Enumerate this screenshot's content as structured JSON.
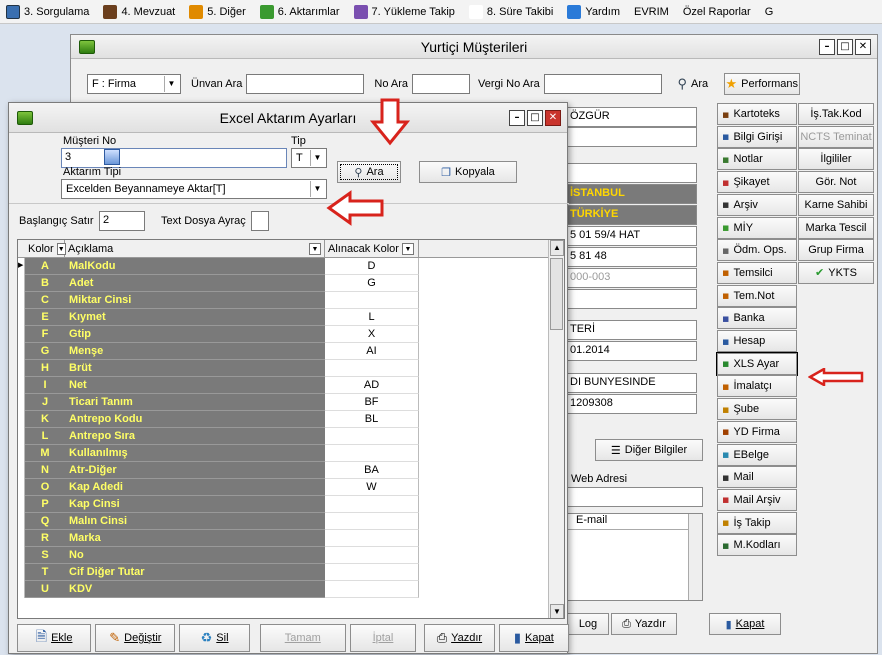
{
  "menubar": {
    "items": [
      {
        "label": "3. Sorgulama",
        "icon": "search-icon"
      },
      {
        "label": "4. Mevzuat",
        "icon": "book-icon"
      },
      {
        "label": "5. Diğer",
        "icon": "people-icon"
      },
      {
        "label": "6. Aktarımlar",
        "icon": "transfer-icon"
      },
      {
        "label": "7. Yükleme Takip",
        "icon": "truck-icon"
      },
      {
        "label": "8. Süre Takibi",
        "icon": "clock-icon"
      },
      {
        "label": "Yardım",
        "icon": "help-icon"
      },
      {
        "label": "EVRIM",
        "icon": ""
      },
      {
        "label": "Özel Raporlar",
        "icon": ""
      },
      {
        "label": "G",
        "icon": ""
      }
    ]
  },
  "main_window": {
    "title": "Yurtiçi Müşterileri",
    "search": {
      "type_value": "F : Firma",
      "unvan_label": "Ünvan Ara",
      "unvan_value": "",
      "no_label": "No Ara",
      "no_value": "",
      "vergi_label": "Vergi No Ara",
      "vergi_value": "",
      "ara_label": "Ara",
      "performans_label": "Performans"
    },
    "fields": {
      "name_partial": "ÖZGÜR",
      "city": "İSTANBUL",
      "country": "TÜRKİYE",
      "phone1": "5 01 59/4 HAT",
      "phone2": "5 81 48",
      "code": "000-003",
      "label_partial": "TERİ",
      "date_partial": "01.2014",
      "office_partial": "DI BUNYESINDE",
      "number_partial": "1209308",
      "diger_bilgiler": "Diğer Bilgiler",
      "web_label": "Web Adresi",
      "email_label": "E-mail",
      "log_label": "Log",
      "yazdir_label": "Yazdır",
      "kapat_label": "Kapat"
    },
    "side_buttons_left": [
      "Kartoteks",
      "Bilgi Girişi",
      "Notlar",
      "Şikayet",
      "Arşiv",
      "MİY",
      "Ödm. Ops.",
      "Temsilci",
      "Tem.Not",
      "Banka",
      "Hesap",
      "XLS Ayar",
      "İmalatçı",
      "Şube",
      "YD Firma",
      "EBelge",
      "Mail",
      "Mail Arşiv",
      "İş Takip",
      "M.Kodları"
    ],
    "side_buttons_right": [
      "İş.Tak.Kod",
      "NCTS Teminat",
      "İlgililer",
      "Gör. Not",
      "Karne Sahibi",
      "Marka Tescil",
      "Grup Firma",
      "YKTS"
    ]
  },
  "dialog": {
    "title": "Excel Aktarım Ayarları",
    "musteri_no_label": "Müşteri No",
    "musteri_no_value": "3",
    "tip_label": "Tip",
    "tip_value": "T",
    "aktarim_tipi_label": "Aktarım Tipi",
    "aktarim_tipi_value": "Excelden Beyannameye Aktar[T]",
    "ara_label": "Ara",
    "kopyala_label": "Kopyala",
    "baslangic_label": "Başlangıç Satır",
    "baslangic_value": "2",
    "ayrac_label": "Text Dosya Ayraç",
    "ayrac_value": "",
    "grid_headers": {
      "kolor": "Kolor",
      "aciklama": "Açıklama",
      "alinacak": "Alınacak Kolor"
    },
    "rows": [
      {
        "kolor": "A",
        "aciklama": "MalKodu",
        "alinacak": "D"
      },
      {
        "kolor": "B",
        "aciklama": "Adet",
        "alinacak": "G"
      },
      {
        "kolor": "C",
        "aciklama": "Miktar Cinsi",
        "alinacak": ""
      },
      {
        "kolor": "E",
        "aciklama": "Kıymet",
        "alinacak": "L"
      },
      {
        "kolor": "F",
        "aciklama": "Gtip",
        "alinacak": "X"
      },
      {
        "kolor": "G",
        "aciklama": "Menşe",
        "alinacak": "AI"
      },
      {
        "kolor": "H",
        "aciklama": "Brüt",
        "alinacak": ""
      },
      {
        "kolor": "I",
        "aciklama": "Net",
        "alinacak": "AD"
      },
      {
        "kolor": "J",
        "aciklama": "Ticari Tanım",
        "alinacak": "BF"
      },
      {
        "kolor": "K",
        "aciklama": "Antrepo Kodu",
        "alinacak": "BL"
      },
      {
        "kolor": "L",
        "aciklama": "Antrepo Sıra",
        "alinacak": ""
      },
      {
        "kolor": "M",
        "aciklama": "Kullanılmış",
        "alinacak": ""
      },
      {
        "kolor": "N",
        "aciklama": "Atr-Diğer",
        "alinacak": "BA"
      },
      {
        "kolor": "O",
        "aciklama": "Kap Adedi",
        "alinacak": "W"
      },
      {
        "kolor": "P",
        "aciklama": "Kap Cinsi",
        "alinacak": ""
      },
      {
        "kolor": "Q",
        "aciklama": "Malın Cinsi",
        "alinacak": ""
      },
      {
        "kolor": "R",
        "aciklama": "Marka",
        "alinacak": ""
      },
      {
        "kolor": "S",
        "aciklama": "No",
        "alinacak": ""
      },
      {
        "kolor": "T",
        "aciklama": "Cif Diğer Tutar",
        "alinacak": ""
      },
      {
        "kolor": "U",
        "aciklama": "KDV",
        "alinacak": ""
      }
    ],
    "buttons": {
      "ekle": "Ekle",
      "degistir": "Değiştir",
      "sil": "Sil",
      "tamam": "Tamam",
      "iptal": "İptal",
      "yazdir": "Yazdır",
      "kapat": "Kapat"
    }
  },
  "colors": {
    "accent_red": "#d8231c",
    "grid_grey": "#7a7a7a",
    "grid_text": "#ffff66"
  }
}
